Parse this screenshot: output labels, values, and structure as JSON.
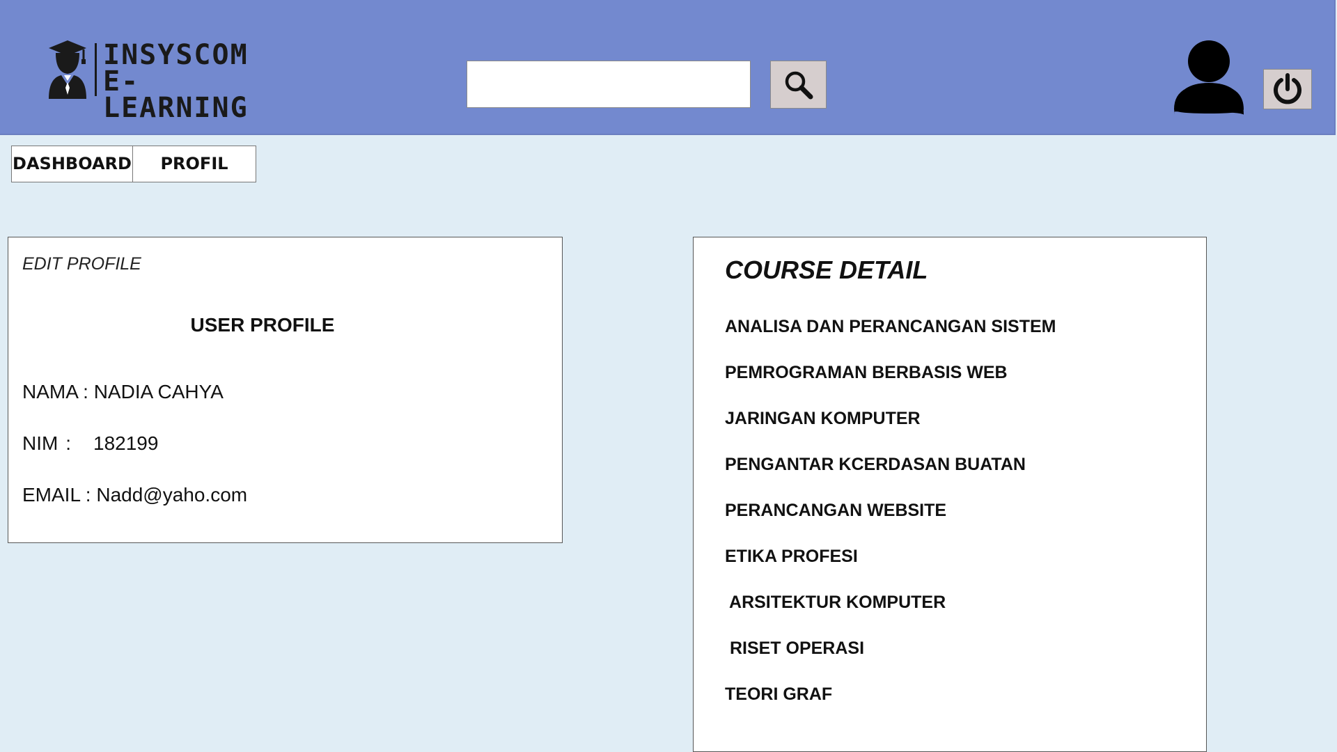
{
  "brand": {
    "line1": "INSYSCOM",
    "line2": "E-LEARNING",
    "logo_icon": "graduate-icon"
  },
  "header": {
    "search_value": "",
    "search_icon": "search-icon",
    "user_icon": "user-icon",
    "power_icon": "power-icon"
  },
  "colors": {
    "header_bg": "#7389cf",
    "page_bg": "#e0edf5",
    "button_bg": "#d6cece"
  },
  "nav": {
    "dashboard": "DASHBOARD",
    "profil": "PROFIL"
  },
  "profile": {
    "edit_label": "EDIT PROFILE",
    "title": "USER PROFILE",
    "nama_label": "NAMA",
    "nama_value": "NADIA CAHYA",
    "nim_label": "NIM",
    "nim_value": "182199",
    "email_label": "EMAIL",
    "email_value": "Nadd@yaho.com"
  },
  "course": {
    "title": "COURSE DETAIL",
    "items": [
      "ANALISA DAN PERANCANGAN SISTEM",
      "PEMROGRAMAN BERBASIS WEB",
      "JARINGAN KOMPUTER",
      "PENGANTAR KCERDASAN BUATAN",
      "PERANCANGAN WEBSITE",
      "ETIKA PROFESI",
      " ARSITEKTUR KOMPUTER",
      " RISET OPERASI",
      "TEORI GRAF"
    ]
  }
}
